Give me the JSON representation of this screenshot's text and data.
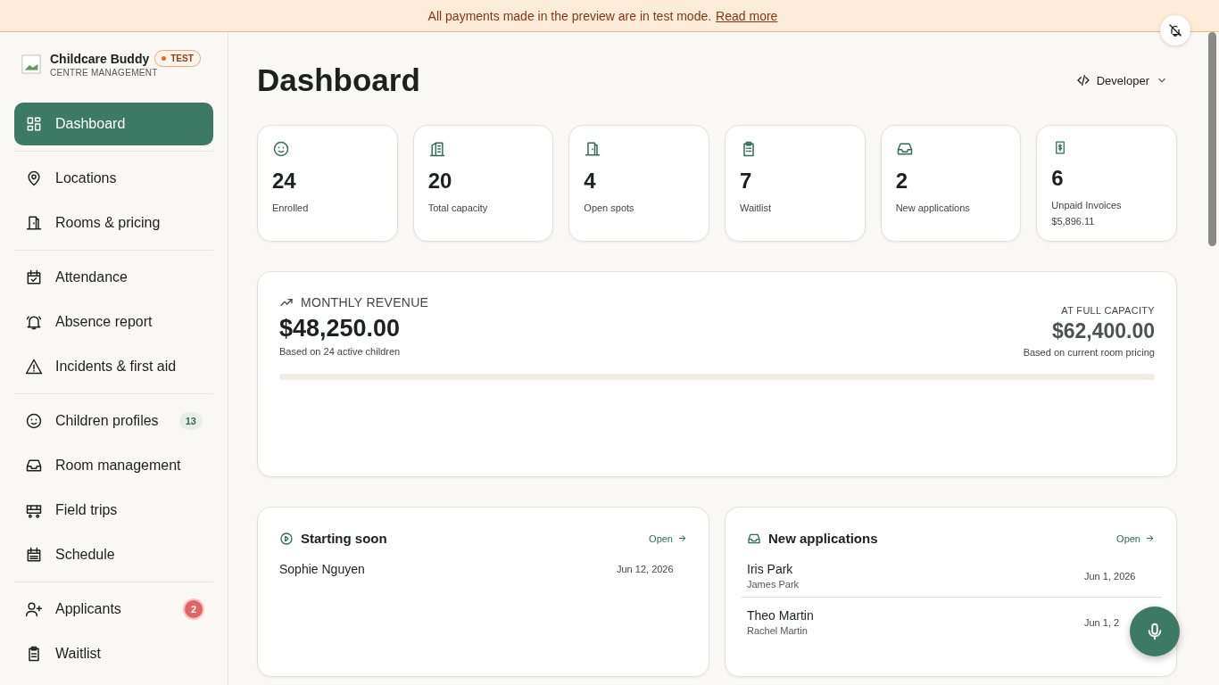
{
  "banner": {
    "text": "All payments made in the preview are in test mode.",
    "link": "Read more"
  },
  "sidebar": {
    "brand": {
      "name": "Childcare Buddy",
      "badge": "TEST",
      "subtitle": "CENTRE MANAGEMENT"
    },
    "groups": [
      {
        "items": [
          {
            "label": "Dashboard",
            "selected": true
          }
        ]
      },
      {
        "items": [
          {
            "label": "Locations",
            "selected": false
          },
          {
            "label": "Rooms & pricing",
            "selected": false
          }
        ]
      },
      {
        "items": [
          {
            "label": "Attendance",
            "selected": false
          },
          {
            "label": "Absence report",
            "selected": false
          },
          {
            "label": "Incidents & first aid",
            "selected": false
          }
        ]
      },
      {
        "items": [
          {
            "label": "Children profiles",
            "selected": false,
            "badge": {
              "text": "13",
              "kind": "neutral"
            }
          },
          {
            "label": "Room management",
            "selected": false
          },
          {
            "label": "Field trips",
            "selected": false
          },
          {
            "label": "Schedule",
            "selected": false
          }
        ]
      },
      {
        "items": [
          {
            "label": "Applicants",
            "selected": false,
            "badge": {
              "text": "2",
              "kind": "alert"
            }
          },
          {
            "label": "Waitlist",
            "selected": false
          }
        ]
      }
    ]
  },
  "header": {
    "title": "Dashboard",
    "role_menu": "Developer"
  },
  "stats": [
    {
      "value": "24",
      "label": "Enrolled"
    },
    {
      "value": "20",
      "label": "Total capacity"
    },
    {
      "value": "4",
      "label": "Open spots"
    },
    {
      "value": "7",
      "label": "Waitlist"
    },
    {
      "value": "2",
      "label": "New applications"
    },
    {
      "value": "6",
      "label": "Unpaid Invoices",
      "sub": "$5,896.11"
    }
  ],
  "revenue": {
    "title": "MONTHLY REVENUE",
    "amount": "$48,250.00",
    "note": "Based on 24 active children",
    "capacity_label": "AT FULL CAPACITY",
    "capacity_amount": "$62,400.00",
    "capacity_note": "Based on current room pricing"
  },
  "panels": [
    {
      "title": "Starting soon",
      "link": "Open",
      "rows": [
        {
          "name": "Sophie Nguyen",
          "date": "Jun 12, 2026"
        }
      ]
    },
    {
      "title": "New applications",
      "link": "Open",
      "rows": [
        {
          "name": "Iris Park",
          "sub": "James Park",
          "date": "Jun 1, 2026"
        },
        {
          "name": "Theo Martin",
          "sub": "Rachel Martin",
          "date": "Jun 1, 2"
        }
      ]
    }
  ]
}
